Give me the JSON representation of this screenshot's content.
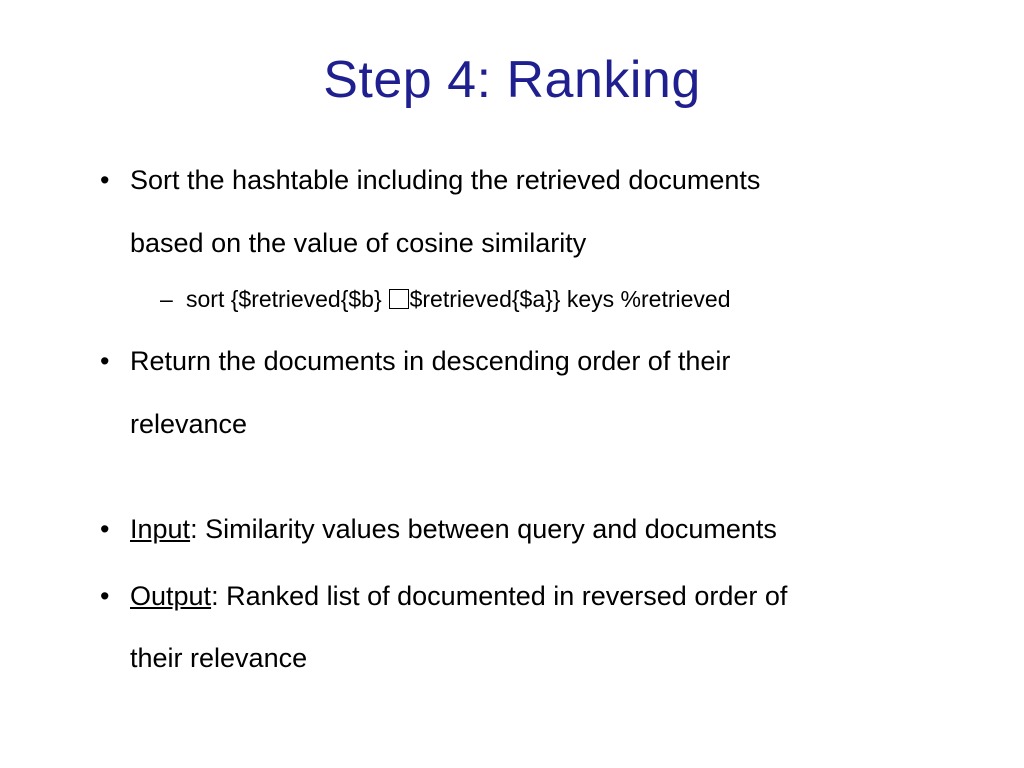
{
  "title": "Step 4: Ranking",
  "bullets": {
    "b1_l1": "Sort the hashtable including the retrieved documents",
    "b1_l2": "based on the value of cosine similarity",
    "b1_sub_pre": "sort {$retrieved{$b} ",
    "b1_sub_post": "$retrieved{$a}} keys %retrieved",
    "b2_l1": "Return the documents in descending order of their",
    "b2_l2": "relevance",
    "b3_label": "Input",
    "b3_text": ": Similarity values between query and documents",
    "b4_label": "Output",
    "b4_text": ": Ranked list of documented in reversed order of",
    "b4_l2": "their relevance"
  }
}
